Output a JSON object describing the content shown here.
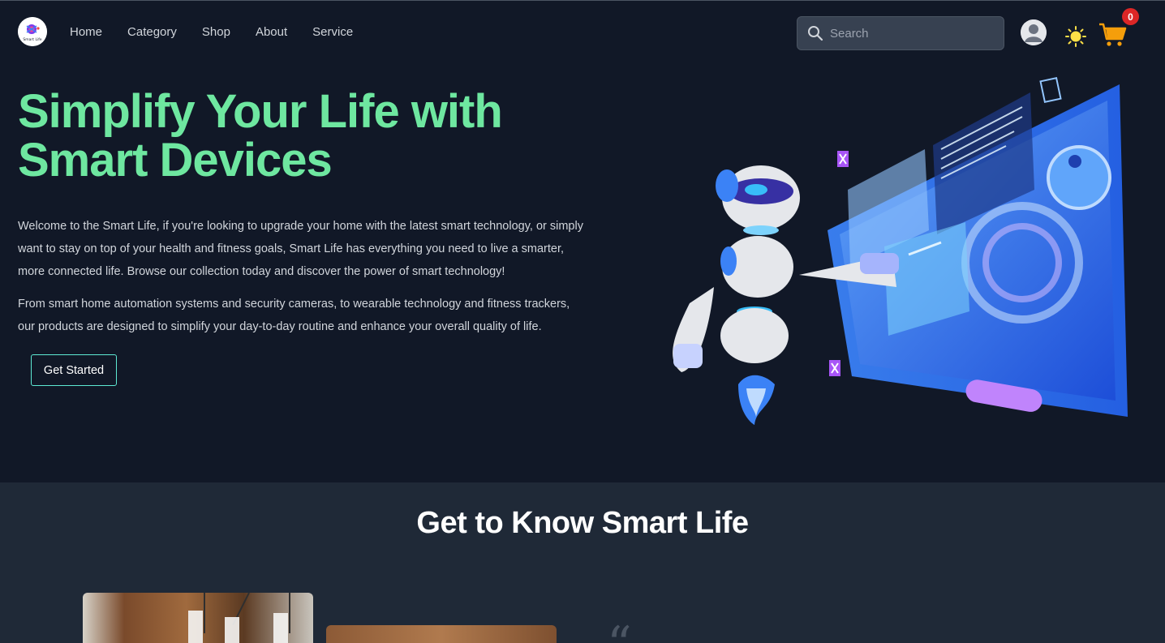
{
  "nav": {
    "logo_text": "Smart Life",
    "links": [
      "Home",
      "Category",
      "Shop",
      "About",
      "Service"
    ],
    "search_placeholder": "Search",
    "cart_count": "0",
    "icons": [
      "search-icon",
      "user-avatar-icon",
      "sun-icon",
      "cart-icon"
    ]
  },
  "hero": {
    "title": "Simplify Your Life with Smart Devices",
    "paragraph1": "Welcome to the Smart Life, if you're looking to upgrade your home with the latest smart technology, or simply want to stay on top of your health and fitness goals, Smart Life has everything you need to live a smarter, more connected life. Browse our collection today and discover the power of smart technology!",
    "paragraph2": "From smart home automation systems and security cameras, to wearable technology and fitness trackers, our products are designed to simplify your day-to-day routine and enhance your overall quality of life.",
    "cta_label": "Get Started"
  },
  "about": {
    "title": "Get to Know Smart Life",
    "quote_glyph": "“"
  },
  "colors": {
    "background": "#111827",
    "section_bg": "#1f2937",
    "accent_green": "#6ee7a0",
    "button_border": "#5eead4",
    "badge": "#dc2626"
  }
}
